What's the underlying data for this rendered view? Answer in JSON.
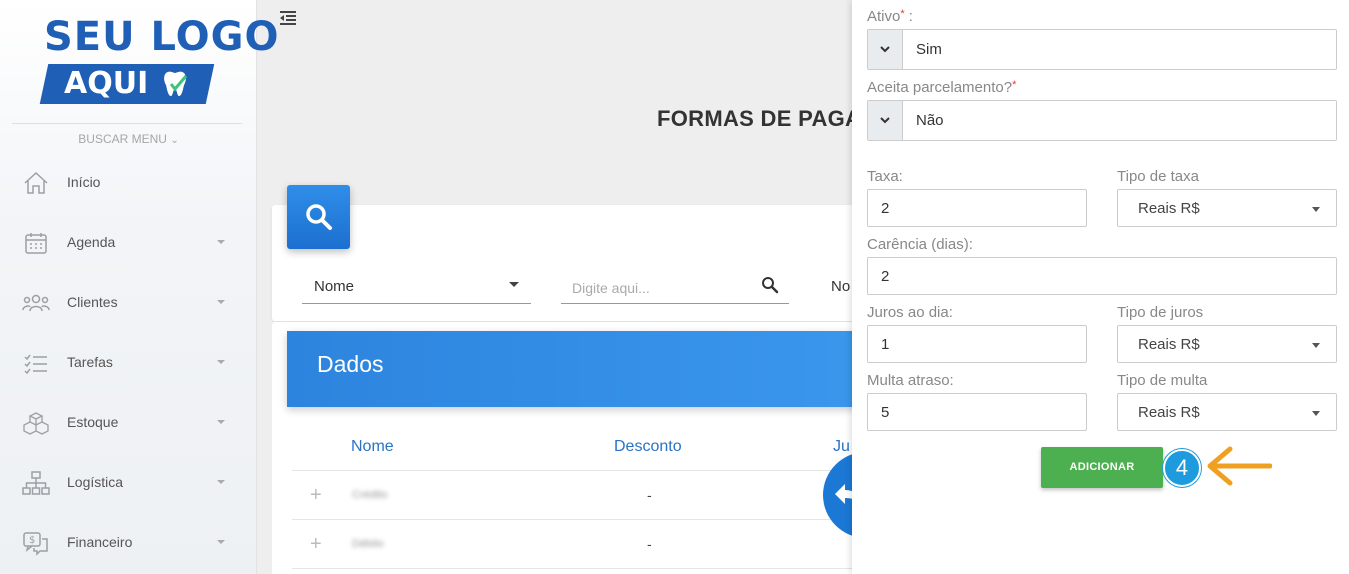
{
  "logo": {
    "line1": "SEU LOGO",
    "line2": "AQUI"
  },
  "sidebar": {
    "search_label": "BUSCAR MENU",
    "items": [
      {
        "label": "Início",
        "icon": "home-icon",
        "has_caret": false
      },
      {
        "label": "Agenda",
        "icon": "calendar-icon",
        "has_caret": true
      },
      {
        "label": "Clientes",
        "icon": "users-icon",
        "has_caret": true
      },
      {
        "label": "Tarefas",
        "icon": "task-list-icon",
        "has_caret": true
      },
      {
        "label": "Estoque",
        "icon": "boxes-icon",
        "has_caret": true
      },
      {
        "label": "Logística",
        "icon": "network-icon",
        "has_caret": true
      },
      {
        "label": "Financeiro",
        "icon": "money-chat-icon",
        "has_caret": true
      }
    ]
  },
  "main": {
    "page_title": "FORMAS DE PAGA",
    "filter": {
      "field_select": "Nome",
      "search_placeholder": "Digite aqui...",
      "third_field": "No"
    },
    "data": {
      "title": "Dados",
      "columns": [
        "Nome",
        "Desconto",
        "Ju"
      ],
      "rows": [
        {
          "name": "Crédito",
          "desconto": "-"
        },
        {
          "name": "Débito",
          "desconto": "-"
        }
      ]
    }
  },
  "panel": {
    "ativo": {
      "label": "Ativo",
      "value": "Sim"
    },
    "parcelamento": {
      "label": "Aceita parcelamento?",
      "value": "Não"
    },
    "taxa": {
      "label": "Taxa:",
      "value": "2"
    },
    "tipo_taxa": {
      "label": "Tipo de taxa",
      "value": "Reais R$"
    },
    "carencia": {
      "label": "Carência (dias):",
      "value": "2"
    },
    "juros": {
      "label": "Juros ao dia:",
      "value": "1"
    },
    "tipo_juros": {
      "label": "Tipo de juros",
      "value": "Reais R$"
    },
    "multa": {
      "label": "Multa atraso:",
      "value": "5"
    },
    "tipo_multa": {
      "label": "Tipo de multa",
      "value": "Reais R$"
    },
    "add_button": "ADICIONAR",
    "step_number": "4",
    "colors": {
      "accent": "#4caf50",
      "badge": "#1e9bdc",
      "arrow": "#f0a020"
    }
  }
}
